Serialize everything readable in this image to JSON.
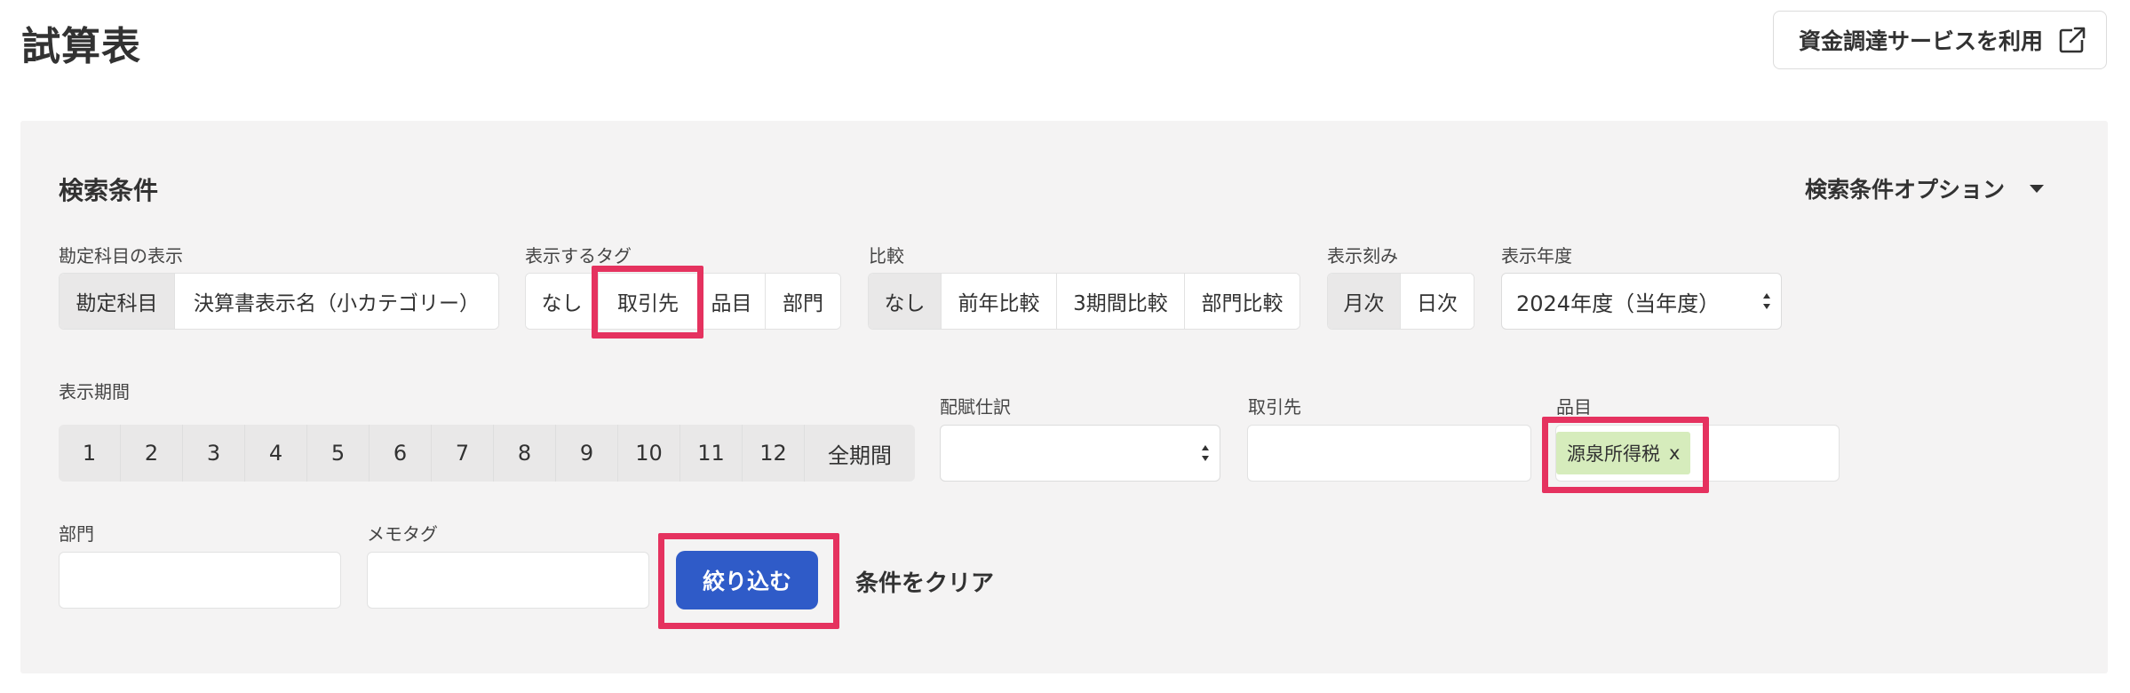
{
  "header": {
    "title": "試算表",
    "funding_button": "資金調達サービスを利用",
    "funding_icon": "external-link-icon"
  },
  "search": {
    "title": "検索条件",
    "options_label": "検索条件オプション",
    "account_display": {
      "label": "勘定科目の表示",
      "options": [
        "勘定科目",
        "決算書表示名（小カテゴリー）"
      ],
      "selected": "勘定科目"
    },
    "tag_display": {
      "label": "表示するタグ",
      "options": [
        "なし",
        "取引先",
        "品目",
        "部門"
      ]
    },
    "comparison": {
      "label": "比較",
      "options": [
        "なし",
        "前年比較",
        "3期間比較",
        "部門比較"
      ],
      "selected": "なし"
    },
    "granularity": {
      "label": "表示刻み",
      "options": [
        "月次",
        "日次"
      ],
      "selected": "月次"
    },
    "fiscal_year": {
      "label": "表示年度",
      "value": "2024年度（当年度）"
    },
    "period": {
      "label": "表示期間",
      "options": [
        "1",
        "2",
        "3",
        "4",
        "5",
        "6",
        "7",
        "8",
        "9",
        "10",
        "11",
        "12",
        "全期間"
      ]
    },
    "allocation": {
      "label": "配賦仕訳",
      "value": ""
    },
    "partner": {
      "label": "取引先",
      "value": ""
    },
    "item": {
      "label": "品目",
      "chip": "源泉所得税",
      "chip_remove": "x"
    },
    "department": {
      "label": "部門",
      "value": ""
    },
    "memo_tag": {
      "label": "メモタグ",
      "value": ""
    },
    "filter_button": "絞り込む",
    "clear_label": "条件をクリア"
  },
  "colors": {
    "primary": "#2f5bc8",
    "highlight": "#e5325f",
    "chip": "#d6ecbc",
    "panel": "#f4f3f3"
  }
}
